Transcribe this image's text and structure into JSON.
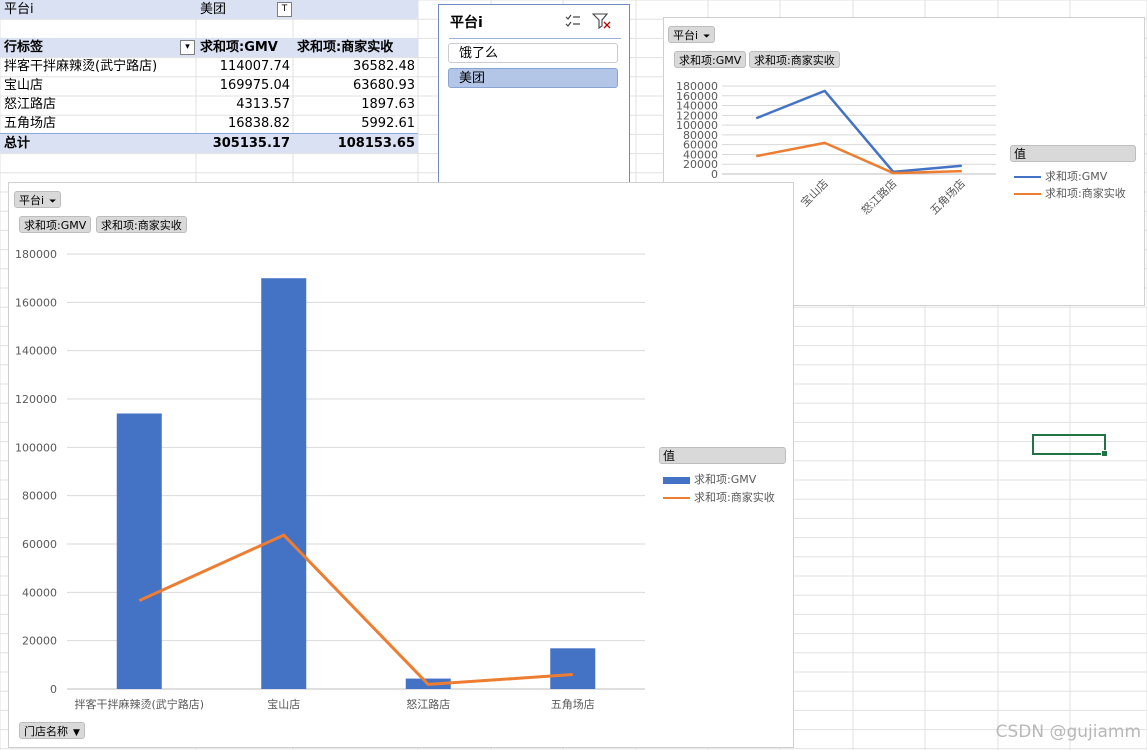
{
  "pivot": {
    "filter_label": "平台i",
    "filter_value": "美团",
    "headers": [
      "行标签",
      "求和项:GMV",
      "求和项:商家实收"
    ],
    "rows": [
      {
        "label": "拌客干拌麻辣烫(武宁路店)",
        "gmv": "114007.74",
        "receipt": "36582.48"
      },
      {
        "label": "宝山店",
        "gmv": "169975.04",
        "receipt": "63680.93"
      },
      {
        "label": "怒江路店",
        "gmv": "4313.57",
        "receipt": "1897.63"
      },
      {
        "label": "五角场店",
        "gmv": "16838.82",
        "receipt": "5992.61"
      }
    ],
    "total": {
      "label": "总计",
      "gmv": "305135.17",
      "receipt": "108153.65"
    }
  },
  "slicer": {
    "title": "平台i",
    "items": [
      {
        "label": "饿了么",
        "selected": false
      },
      {
        "label": "美团",
        "selected": true
      }
    ]
  },
  "chart_common": {
    "filter_chip": "平台i",
    "value_chips": [
      "求和项:GMV",
      "求和项:商家实收"
    ],
    "axis_chip": "门店名称",
    "legend_title": "值",
    "series_colors": {
      "gmv": "#4472c4",
      "receipt": "#ed7d31"
    }
  },
  "chart_data": [
    {
      "type": "line",
      "categories": [
        "拌客干拌麻辣烫(武宁路店)",
        "宝山店",
        "怒江路店",
        "五角场店"
      ],
      "category_labels_display": [
        "拌客干拌麻辣烫(武…",
        "宝山店",
        "怒江路店",
        "五角场店"
      ],
      "series": [
        {
          "name": "求和项:GMV",
          "values": [
            114007.74,
            169975.04,
            4313.57,
            16838.82
          ]
        },
        {
          "name": "求和项:商家实收",
          "values": [
            36582.48,
            63680.93,
            1897.63,
            5992.61
          ]
        }
      ],
      "ylim": [
        0,
        180000
      ],
      "yticks": [
        "0",
        "20000",
        "40000",
        "60000",
        "80000",
        "100000",
        "120000",
        "140000",
        "160000",
        "180000"
      ],
      "grid": true,
      "legend": "right"
    },
    {
      "type": "bar",
      "categories": [
        "拌客干拌麻辣烫(武宁路店)",
        "宝山店",
        "怒江路店",
        "五角场店"
      ],
      "series": [
        {
          "name": "求和项:GMV",
          "type": "bar",
          "values": [
            114007.74,
            169975.04,
            4313.57,
            16838.82
          ]
        },
        {
          "name": "求和项:商家实收",
          "type": "line",
          "values": [
            36582.48,
            63680.93,
            1897.63,
            5992.61
          ]
        }
      ],
      "ylim": [
        0,
        180000
      ],
      "yticks": [
        "0",
        "20000",
        "40000",
        "60000",
        "80000",
        "100000",
        "120000",
        "140000",
        "160000",
        "180000"
      ],
      "grid": true,
      "legend": "right"
    }
  ],
  "watermark": "CSDN @gujiamm"
}
